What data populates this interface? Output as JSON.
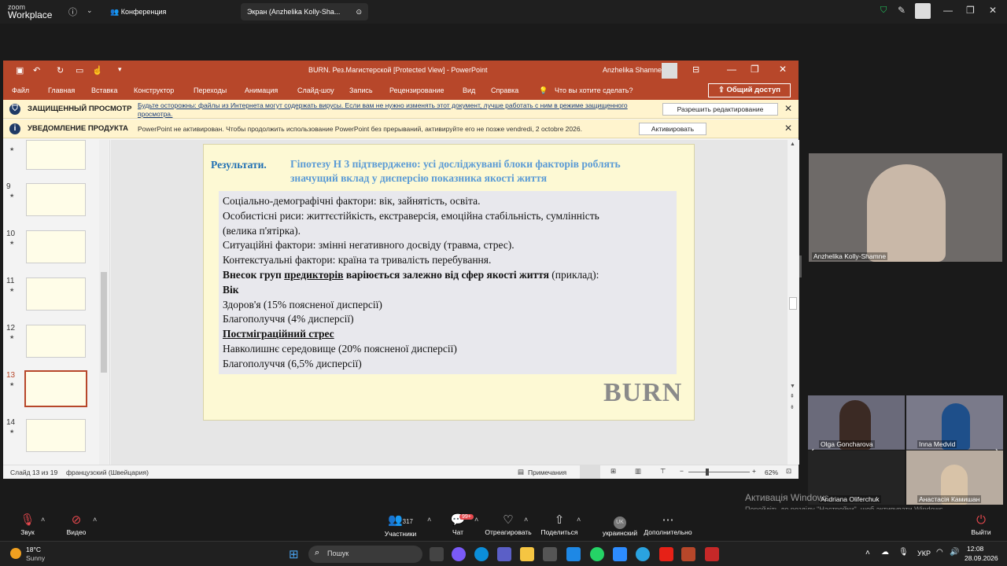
{
  "zoom": {
    "logo_line1": "zoom",
    "logo_line2": "Workplace",
    "tab_conference": "Конференция",
    "tab_screen": "Экран (Anzhelika Kolly-Sha...",
    "bottom": {
      "audio": "Звук",
      "video": "Видео",
      "participants": "Участники",
      "participants_count": "317",
      "chat": "Чат",
      "chat_badge": "99+",
      "react": "Отреагировать",
      "share": "Поделиться",
      "language": "украинский",
      "language_code": "UK",
      "more": "Дополнительно",
      "leave": "Выйти"
    },
    "watermark_title": "Активація Windows",
    "watermark_text": "Перейдіть до розділу \"Настройки\", щоб активувати Windows."
  },
  "ppt": {
    "title": "BURN. Рез.Магистерской [Protected View]  -  PowerPoint",
    "user": "Anzhelika Shamne",
    "menu": [
      "Файл",
      "Главная",
      "Вставка",
      "Конструктор",
      "Переходы",
      "Анимация",
      "Слайд-шоу",
      "Запись",
      "Рецензирование",
      "Вид",
      "Справка"
    ],
    "tell_me": "Что вы хотите сделать?",
    "share_button": "Общий доступ",
    "protected_label": "ЗАЩИЩЕННЫЙ ПРОСМОТР",
    "protected_msg": "Будьте осторожны: файлы из Интернета могут содержать вирусы. Если вам не нужно изменять этот документ, лучше работать с ним в режиме защищенного просмотра.",
    "enable_editing": "Разрешить редактирование",
    "product_label": "УВЕДОМЛЕНИЕ ПРОДУКТА",
    "product_msg": "PowerPoint не активирован. Чтобы продолжить использование PowerPoint без прерываний, активируйте его не позже vendredi, 2 octobre 2026.",
    "activate": "Активировать",
    "thumb_numbers": [
      "9",
      "10",
      "11",
      "12",
      "13",
      "14"
    ],
    "status_slide": "Слайд 13 из 19",
    "status_lang": "французский (Швейцария)",
    "status_notes": "Примечания",
    "zoom_level": "62%"
  },
  "slide": {
    "heading": "Результати.",
    "subheading": "Гіпотезу Н 3 підтверджено: усі досліджувані блоки факторів роблять значущий вклад у дисперсію показника якості життя",
    "line1": "Соціально-демографічні фактори: вік, зайнятість, освіта.",
    "line2": "Особистісні риси: життєстійкість, екстраверсія, емоційна стабільність, сумлінність",
    "line3": "(велика п'ятірка).",
    "line4": "Ситуаційні фактори:  змінні негативного досвіду (травма, стрес).",
    "line5": "Контекстуальні фактори: країна та тривалість перебування.",
    "line6a": " Внесок груп ",
    "line6b": "предикторів",
    "line6c": " варіюється залежно від сфер якості життя",
    "line6d": " (приклад):",
    "line7": "Вік",
    "line8": "Здоров'я (15% поясненої дисперсії)",
    "line9": "Благополуччя (4% дисперсії)",
    "line10": "Постміграційний стрес",
    "line11": "Навколишнє середовище (20% поясненої дисперсії)",
    "line12": " Благополуччя (6,5% дисперсії)",
    "logo": "BURN"
  },
  "participants": {
    "speaker": "Anzhelika Kolly-Shamne",
    "p1": "Olga Goncharova",
    "p2": "Inna Medvid",
    "p3": "Andriana Oliferchuk",
    "p4": "Анастасія Камишан"
  },
  "taskbar": {
    "temp": "18°C",
    "weather": "Sunny",
    "search": "Пошук",
    "lang": "УКР",
    "time": "12:08",
    "date": "28.09.2026"
  }
}
